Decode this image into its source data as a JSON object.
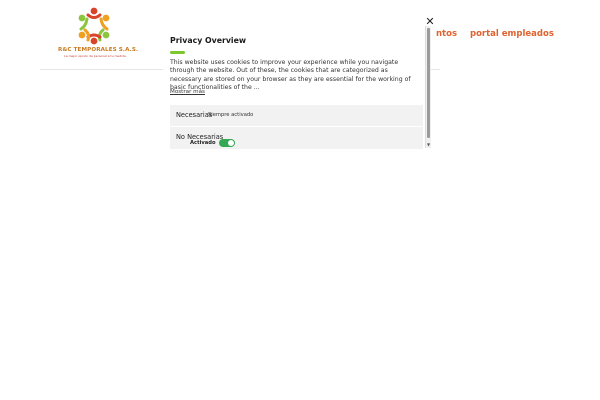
{
  "header": {
    "logo": {
      "name": "R&C TEMPORALES S.A.S.",
      "tagline": "La mejor opción de personal a tu medida"
    },
    "nav": {
      "partial_label": "ntos",
      "portal_label": "portal empleados"
    },
    "accent_color": "#e0622f"
  },
  "privacy": {
    "title": "Privacy Overview",
    "description": "This website uses cookies to improve your experience while you navigate through the website. Out of these, the cookies that are categorized as necessary are stored on your browser as they are essential for the working of basic functionalities of the ...",
    "show_more": "Mostrar más",
    "categories": [
      {
        "label": "Necesarias",
        "status": "Siempre activado"
      },
      {
        "label": "No Necesarias",
        "toggle_label": "Activado",
        "enabled": true
      }
    ],
    "close_icon": "close-icon",
    "accent_color": "#7bc72c",
    "toggle_color": "#34a853"
  }
}
